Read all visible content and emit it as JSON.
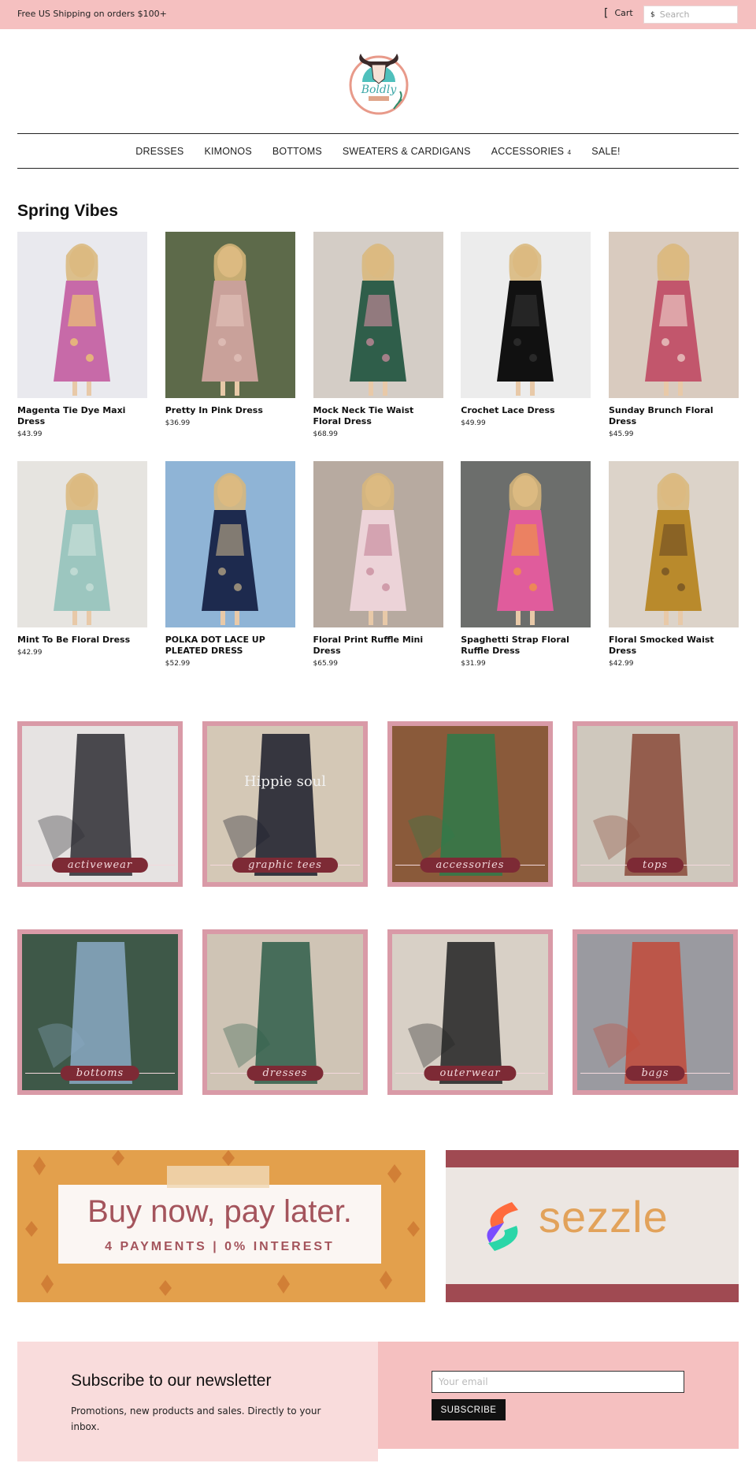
{
  "topbar": {
    "shipping": "Free US Shipping on orders $100+",
    "cart_label": "Cart",
    "search_placeholder": "Search"
  },
  "brand": {
    "logo_text": "Boldly",
    "logo_icon": "bull-skull-logo"
  },
  "nav": {
    "items": [
      {
        "label": "DRESSES"
      },
      {
        "label": "KIMONOS"
      },
      {
        "label": "BOTTOMS"
      },
      {
        "label": "SWEATERS & CARDIGANS"
      },
      {
        "label": "ACCESSORIES",
        "has_dropdown": true,
        "icon": "chevron-down-icon"
      },
      {
        "label": "SALE!"
      }
    ]
  },
  "section": {
    "title": "Spring Vibes"
  },
  "products": [
    {
      "name": "Magenta Tie Dye Maxi Dress",
      "price": "$43.99",
      "bg": "#e9e9ee",
      "c1": "#c76aa8",
      "c2": "#f2d36b"
    },
    {
      "name": "Pretty In Pink Dress",
      "price": "$36.99",
      "bg": "#5d6a4a",
      "c1": "#c9a19a",
      "c2": "#e4c4bd"
    },
    {
      "name": "Mock Neck Tie Waist Floral Dress",
      "price": "$68.99",
      "bg": "#d4cdc6",
      "c1": "#2f5e4a",
      "c2": "#d58da2"
    },
    {
      "name": "Crochet Lace Dress",
      "price": "$49.99",
      "bg": "#ececec",
      "c1": "#111111",
      "c2": "#333333"
    },
    {
      "name": "Sunday Brunch Floral Dress",
      "price": "$45.99",
      "bg": "#d9cbbf",
      "c1": "#c2566c",
      "c2": "#f0d8d0"
    },
    {
      "name": "Mint To Be Floral Dress",
      "price": "$42.99",
      "bg": "#e6e4e0",
      "c1": "#9cc6bf",
      "c2": "#cfe2dc"
    },
    {
      "name": "POLKA DOT LACE UP PLEATED DRESS",
      "price": "$52.99",
      "bg": "#8fb4d6",
      "c1": "#1d2a4e",
      "c2": "#c6b28a"
    },
    {
      "name": "Floral Print Ruffle Mini Dress",
      "price": "$65.99",
      "bg": "#b7aaa0",
      "c1": "#ecd3d8",
      "c2": "#c58497"
    },
    {
      "name": "Spaghetti Strap Floral Ruffle Dress",
      "price": "$31.99",
      "bg": "#6c6e6c",
      "c1": "#e05c9c",
      "c2": "#f29a3c"
    },
    {
      "name": "Floral Smocked Waist Dress",
      "price": "$42.99",
      "bg": "#dcd3c9",
      "c1": "#b98a2c",
      "c2": "#6a4a22"
    }
  ],
  "categories": [
    {
      "label": "activewear",
      "bg": "#e6e3e2",
      "c1": "#2d2d33"
    },
    {
      "label": "graphic tees",
      "bg": "#d4c8b6",
      "c1": "#1a1c2a",
      "text": "Hippie soul"
    },
    {
      "label": "accessories",
      "bg": "#8a5a3a",
      "c1": "#2e7a4a"
    },
    {
      "label": "tops",
      "bg": "#cfc8bd",
      "c1": "#8a4a3a"
    },
    {
      "label": "bottoms",
      "bg": "#3e5848",
      "c1": "#8aa9c4"
    },
    {
      "label": "dresses",
      "bg": "#cfc4b5",
      "c1": "#2f5e4a"
    },
    {
      "label": "outerwear",
      "bg": "#d8d0c6",
      "c1": "#222222"
    },
    {
      "label": "bags",
      "bg": "#9a9aa0",
      "c1": "#c24a3a"
    }
  ],
  "banners": {
    "bnpl_title": "Buy now, pay later.",
    "bnpl_sub": "4 PAYMENTS | 0% INTEREST",
    "sezzle_word": "sezzle"
  },
  "newsletter": {
    "title": "Subscribe to our newsletter",
    "text": "Promotions, new products and sales. Directly to your inbox.",
    "email_placeholder": "Your email",
    "button": "SUBSCRIBE"
  }
}
